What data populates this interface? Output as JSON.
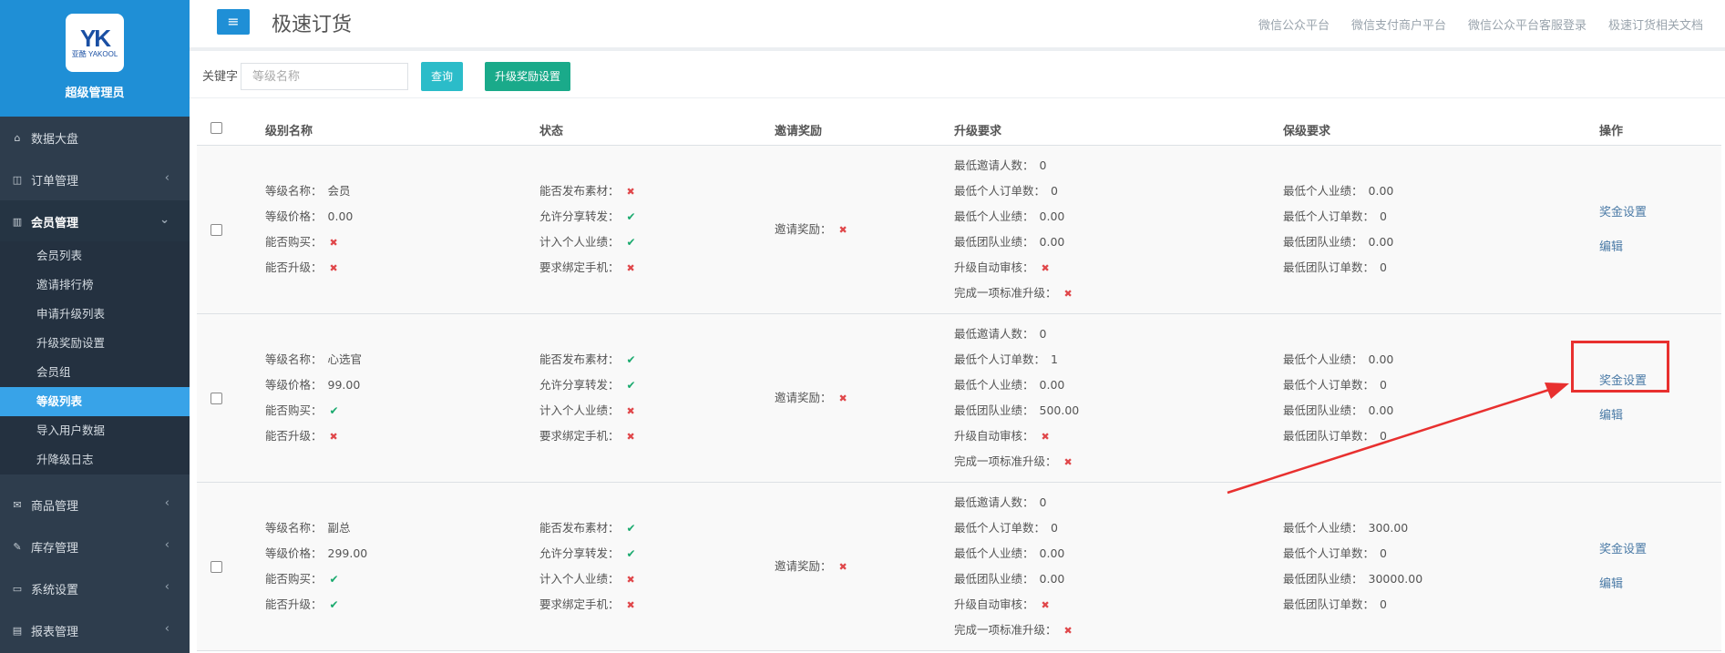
{
  "brand": {
    "logo_text": "YK",
    "logo_sub": "亚酷 YAKOOL",
    "admin_label": "超级管理员"
  },
  "nav": [
    {
      "label": "数据大盘",
      "icon": "home-icon",
      "chevron": ""
    },
    {
      "label": "订单管理",
      "icon": "columns-icon",
      "chevron": "‹"
    },
    {
      "label": "会员管理",
      "icon": "bar-chart-icon",
      "chevron": "⌄"
    },
    {
      "label": "商品管理",
      "icon": "envelope-icon",
      "chevron": "‹"
    },
    {
      "label": "库存管理",
      "icon": "edit-icon",
      "chevron": "‹"
    },
    {
      "label": "系统设置",
      "icon": "monitor-icon",
      "chevron": "‹"
    },
    {
      "label": "报表管理",
      "icon": "chart-icon",
      "chevron": "‹"
    }
  ],
  "subnav": [
    "会员列表",
    "邀请排行榜",
    "申请升级列表",
    "升级奖励设置",
    "会员组",
    "等级列表",
    "导入用户数据",
    "升降级日志"
  ],
  "header": {
    "menu_icon": "≡",
    "title": "极速订货",
    "links": [
      "微信公众平台",
      "微信支付商户平台",
      "微信公众平台客服登录",
      "极速订货相关文档"
    ]
  },
  "toolbar": {
    "keyword_label": "关键字",
    "placeholder": "等级名称",
    "query_label": "查询",
    "upgrade_label": "升级奖励设置"
  },
  "table": {
    "headers": [
      "级别名称",
      "状态",
      "邀请奖励",
      "升级要求",
      "保级要求",
      "操作"
    ],
    "rows": [
      {
        "name": [
          "等级名称：",
          "会员"
        ],
        "price": [
          "等级价格：",
          "0.00"
        ],
        "buy": [
          "能否购买：",
          "x"
        ],
        "upgrade": [
          "能否升级：",
          "x"
        ],
        "status": [
          [
            "能否发布素材：",
            "x"
          ],
          [
            "允许分享转发：",
            "v"
          ],
          [
            "计入个人业绩：",
            "v"
          ],
          [
            "要求绑定手机：",
            "x"
          ]
        ],
        "invite": [
          "邀请奖励：",
          "x"
        ],
        "req": [
          [
            "最低邀请人数：",
            "0"
          ],
          [
            "最低个人订单数：",
            "0"
          ],
          [
            "最低个人业绩：",
            "0.00"
          ],
          [
            "最低团队业绩：",
            "0.00"
          ],
          [
            "升级自动审核：",
            "x"
          ],
          [
            "完成一项标准升级：",
            "x"
          ]
        ],
        "keep": [
          [
            "最低个人业绩：",
            "0.00"
          ],
          [
            "最低个人订单数：",
            "0"
          ],
          [
            "最低团队业绩：",
            "0.00"
          ],
          [
            "最低团队订单数：",
            "0"
          ]
        ],
        "actions": [
          "奖金设置",
          "编辑"
        ]
      },
      {
        "name": [
          "等级名称：",
          "心选官"
        ],
        "price": [
          "等级价格：",
          "99.00"
        ],
        "buy": [
          "能否购买：",
          "v"
        ],
        "upgrade": [
          "能否升级：",
          "x"
        ],
        "status": [
          [
            "能否发布素材：",
            "v"
          ],
          [
            "允许分享转发：",
            "v"
          ],
          [
            "计入个人业绩：",
            "x"
          ],
          [
            "要求绑定手机：",
            "x"
          ]
        ],
        "invite": [
          "邀请奖励：",
          "x"
        ],
        "req": [
          [
            "最低邀请人数：",
            "0"
          ],
          [
            "最低个人订单数：",
            "1"
          ],
          [
            "最低个人业绩：",
            "0.00"
          ],
          [
            "最低团队业绩：",
            "500.00"
          ],
          [
            "升级自动审核：",
            "x"
          ],
          [
            "完成一项标准升级：",
            "x"
          ]
        ],
        "keep": [
          [
            "最低个人业绩：",
            "0.00"
          ],
          [
            "最低个人订单数：",
            "0"
          ],
          [
            "最低团队业绩：",
            "0.00"
          ],
          [
            "最低团队订单数：",
            "0"
          ]
        ],
        "actions": [
          "奖金设置",
          "编辑"
        ]
      },
      {
        "name": [
          "等级名称：",
          "副总"
        ],
        "price": [
          "等级价格：",
          "299.00"
        ],
        "buy": [
          "能否购买：",
          "v"
        ],
        "upgrade": [
          "能否升级：",
          "v"
        ],
        "status": [
          [
            "能否发布素材：",
            "v"
          ],
          [
            "允许分享转发：",
            "v"
          ],
          [
            "计入个人业绩：",
            "x"
          ],
          [
            "要求绑定手机：",
            "x"
          ]
        ],
        "invite": [
          "邀请奖励：",
          "x"
        ],
        "req": [
          [
            "最低邀请人数：",
            "0"
          ],
          [
            "最低个人订单数：",
            "0"
          ],
          [
            "最低个人业绩：",
            "0.00"
          ],
          [
            "最低团队业绩：",
            "0.00"
          ],
          [
            "升级自动审核：",
            "x"
          ],
          [
            "完成一项标准升级：",
            "x"
          ]
        ],
        "keep": [
          [
            "最低个人业绩：",
            "300.00"
          ],
          [
            "最低个人订单数：",
            "0"
          ],
          [
            "最低团队业绩：",
            "30000.00"
          ],
          [
            "最低团队订单数：",
            "0"
          ]
        ],
        "actions": [
          "奖金设置",
          "编辑"
        ]
      }
    ]
  },
  "colors": {
    "sidebar": "#2e3d4d",
    "brand": "#1f8fd6",
    "active_sub": "#38a3e8",
    "annotation": "#e8302f",
    "check": "#1aaa6e",
    "cross": "#e0474a"
  }
}
